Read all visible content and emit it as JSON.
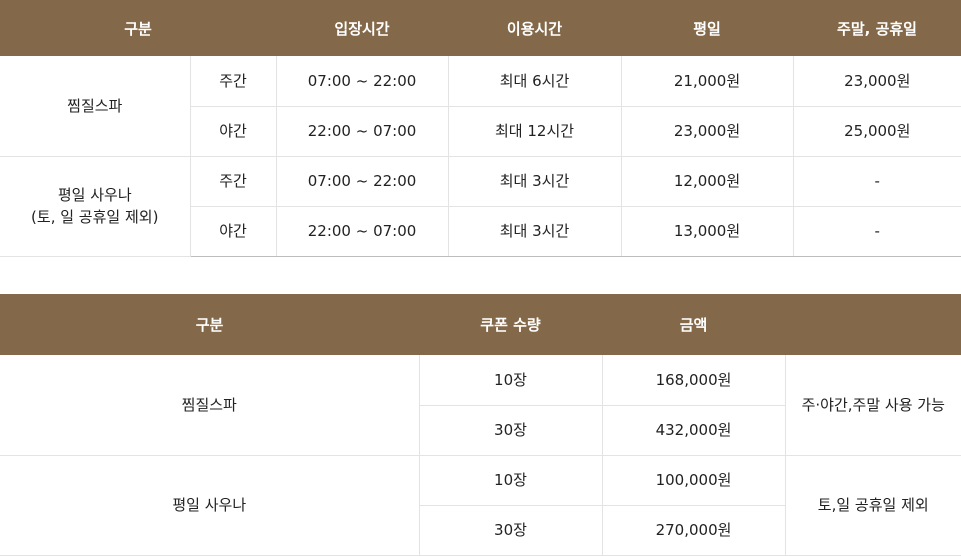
{
  "table1": {
    "headers": [
      "구분",
      "입장시간",
      "이용시간",
      "평일",
      "주말, 공휴일"
    ],
    "groups": [
      {
        "label": "찜질스파",
        "rows": [
          {
            "period": "주간",
            "entry": "07:00 ~ 22:00",
            "usage": "최대 6시간",
            "weekday": "21,000원",
            "weekend": "23,000원"
          },
          {
            "period": "야간",
            "entry": "22:00 ~ 07:00",
            "usage": "최대 12시간",
            "weekday": "23,000원",
            "weekend": "25,000원"
          }
        ]
      },
      {
        "label_line1": "평일 사우나",
        "label_line2": "(토, 일 공휴일 제외)",
        "rows": [
          {
            "period": "주간",
            "entry": "07:00 ~ 22:00",
            "usage": "최대 3시간",
            "weekday": "12,000원",
            "weekend": "-"
          },
          {
            "period": "야간",
            "entry": "22:00 ~ 07:00",
            "usage": "최대 3시간",
            "weekday": "13,000원",
            "weekend": "-"
          }
        ]
      }
    ]
  },
  "table2": {
    "headers": [
      "구분",
      "쿠폰 수량",
      "금액"
    ],
    "groups": [
      {
        "label": "찜질스파",
        "note": "주·야간,주말 사용 가능",
        "rows": [
          {
            "qty": "10장",
            "price": "168,000원"
          },
          {
            "qty": "30장",
            "price": "432,000원"
          }
        ]
      },
      {
        "label": "평일 사우나",
        "note": "토,일 공휴일 제외",
        "rows": [
          {
            "qty": "10장",
            "price": "100,000원"
          },
          {
            "qty": "30장",
            "price": "270,000원"
          }
        ]
      }
    ]
  },
  "colors": {
    "header_bg": "#836849",
    "header_text": "#ffffff",
    "border": "#e3e3e3"
  }
}
